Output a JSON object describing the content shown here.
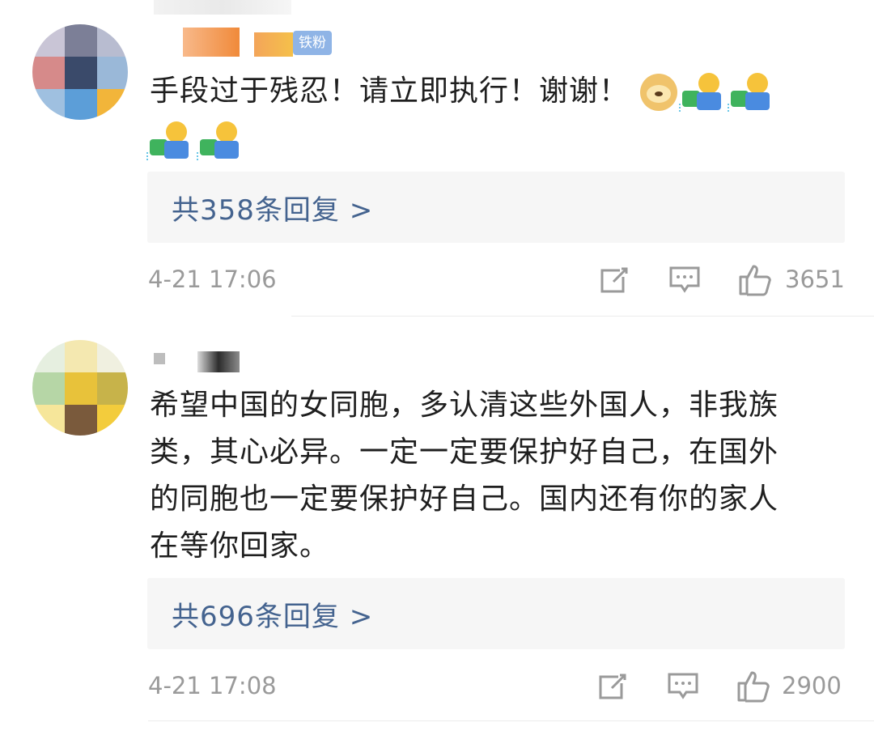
{
  "comments": [
    {
      "badge": "铁粉",
      "text_line1": "手段过于残忍！请立即执行！谢谢！",
      "emoji_row1": [
        "doge-icon",
        "watering-icon",
        "watering-icon"
      ],
      "emoji_row2": [
        "watering-icon",
        "watering-icon"
      ],
      "reply_label": "共358条回复 >",
      "time": "4-21 17:06",
      "likes": "3651"
    },
    {
      "text_lines": [
        "希望中国的女同胞，多认清这些外国人，非我族",
        "类，其心必异。一定一定要保护好自己，在国外",
        "的同胞也一定要保护好自己。国内还有你的家人",
        "在等你回家。"
      ],
      "reply_label": "共696条回复 >",
      "time": "4-21 17:08",
      "likes": "2900"
    }
  ],
  "colors": {
    "reply_link": "#44638f",
    "meta_gray": "#9a9a9a",
    "badge_blue": "#8fb4e6",
    "reply_bg": "#f6f6f6"
  }
}
